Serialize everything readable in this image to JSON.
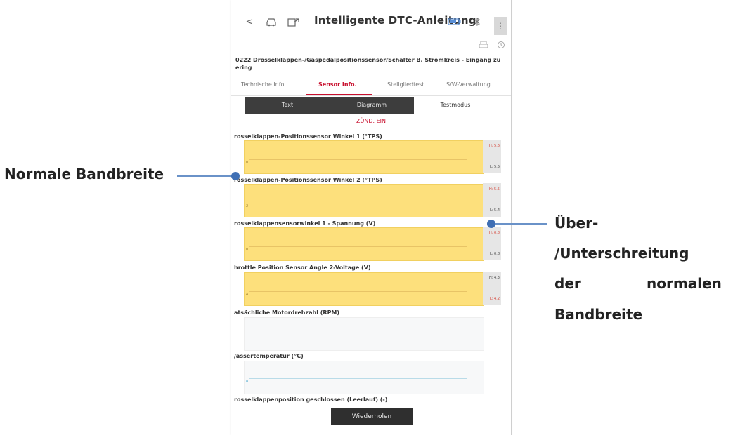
{
  "header": {
    "back_glyph": "<",
    "car_icon": "car-icon",
    "export_icon": "export-icon",
    "title": "Intelligente DTC-Anleitung",
    "battery_icon": "battery-icon",
    "bluetooth_icon": "bluetooth-icon",
    "menu_glyph": "⋮"
  },
  "toolbar": {
    "print_icon": "print-icon",
    "refresh_icon": "refresh-icon"
  },
  "dtc": {
    "description": "0222 Drosselklappen-/Gaspedalpositionssensor/Schalter B, Stromkreis - Eingang zu\nering"
  },
  "tabs": [
    "Technische Info.",
    "Sensor Info.",
    "Stellgliedtest",
    "S/W-Verwaltung"
  ],
  "active_tab": "Sensor Info.",
  "view_modes": [
    "Text",
    "Diagramm",
    "Testmodus"
  ],
  "ignition_status": "ZÜND. EIN",
  "sensors": [
    {
      "label": "rosselklappen-Positionssensor Winkel 1 (°TPS)",
      "value_mark": "0",
      "high": "H: 5.6",
      "low": "L: 5.5",
      "high_out": true,
      "low_out": false
    },
    {
      "label": "rosselklappen-Positionssensor Winkel 2 (°TPS)",
      "value_mark": "2",
      "high": "H: 5.5",
      "low": "L: 5.4",
      "high_out": true,
      "low_out": false
    },
    {
      "label": "rosselklappensensorwinkel 1 - Spannung (V)",
      "value_mark": "0",
      "high": "H: 0.8",
      "low": "L: 0.8",
      "high_out": true,
      "low_out": false
    },
    {
      "label": "hrottle Position Sensor Angle 2-Voltage (V)",
      "value_mark": "4",
      "high": "H: 4.3",
      "low": "L: 4.2",
      "high_out": false,
      "low_out": true
    },
    {
      "label": "atsächliche Motordrehzahl (RPM)",
      "value_mark": "",
      "high": "",
      "low": ""
    },
    {
      "label": "/assertemperatur (°C)",
      "value_mark": "8",
      "high": "",
      "low": ""
    },
    {
      "label": "rosselklappenposition geschlossen (Leerlauf) (-)",
      "value_mark": "",
      "high": "",
      "low": ""
    }
  ],
  "buttons": {
    "repeat": "Wiederholen"
  },
  "annotations": {
    "left": "Normale Bandbreite",
    "right_lines": [
      "Über-",
      "/Unterschreitung",
      "der",
      "normalen",
      "Bandbreite"
    ]
  },
  "colors": {
    "accent_red": "#c8102e",
    "out_of_range_fill": "#fde07c",
    "annotation_blue": "#3f6fb4"
  }
}
